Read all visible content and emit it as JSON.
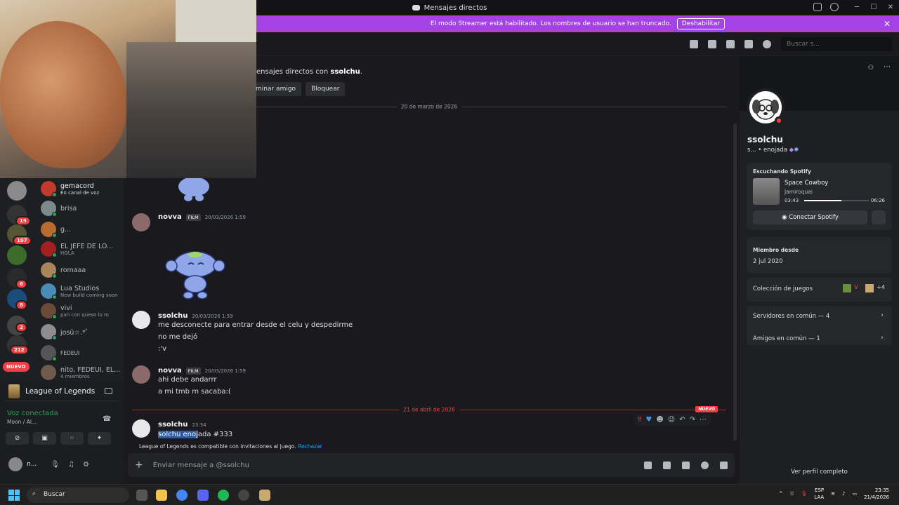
{
  "window": {
    "title": "Mensajes directos"
  },
  "banner": {
    "text": "El modo Streamer está habilitado. Los nombres de usuario se han truncado.",
    "button": "Deshabilitar"
  },
  "search": {
    "placeholder": "Buscar s..."
  },
  "servers": {
    "badges": [
      "15",
      "107",
      "6",
      "8",
      "2",
      "212"
    ],
    "nuevo": "NUEVO"
  },
  "dms": [
    {
      "name": "gemacord",
      "sub": "En canal de voz",
      "color": "#c0392b"
    },
    {
      "name": "brisa",
      "sub": "",
      "color": "#7d8a8b"
    },
    {
      "name": "g...",
      "sub": "",
      "color": "#b86b2e"
    },
    {
      "name": "EL JEFE DE LO...",
      "sub": "HOLA",
      "color": "#a32020"
    },
    {
      "name": "romaaa",
      "sub": "",
      "color": "#a8855a"
    },
    {
      "name": "Lua Studios",
      "sub": "New build coming soon",
      "color": "#4a8cb8"
    },
    {
      "name": "vivi",
      "sub": "pan con queso lo m",
      "color": "#6b4a3a"
    },
    {
      "name": "josü☆.*ﾟ",
      "sub": "",
      "color": "#8e8e8e"
    },
    {
      "name": "FEDEUI",
      "sub": "",
      "color": "#555555"
    },
    {
      "name": "nito, FEDEUI, EL ...",
      "sub": "4 miembros",
      "color": "#6f5b4b"
    }
  ],
  "activity": {
    "game": "League of Legends",
    "voice_title": "Voz conectada",
    "voice_sub": "Moon / Al..."
  },
  "user": {
    "name": "n..."
  },
  "chat": {
    "intro_prefix": "ensajes directos con",
    "intro_user": "ssolchu",
    "intro_btn1": "minar amigo",
    "intro_btn2": "Bloquear",
    "date1": "20 de marzo de 2026",
    "date2": "21 de abril de 2026",
    "nuevo": "NUEVO",
    "messages": [
      {
        "author": "novva",
        "tag": "FILM",
        "ts": "20/03/2026 1:59"
      },
      {
        "author": "ssolchu",
        "ts": "20/03/2026 1:59",
        "lines": [
          "me desconecte para entrar desde el celu y despedirme",
          "no me dejó",
          ":'v"
        ]
      },
      {
        "author": "novva",
        "tag": "FILM",
        "ts": "20/03/2026 1:59",
        "lines": [
          "ahi debe andarrr",
          "a mi tmb m sacaba:("
        ]
      },
      {
        "author": "ssolchu",
        "ts": "23:34",
        "sel": "solchu enoj",
        "rest": "ada #333"
      }
    ],
    "gamelink_game": "League of Legends",
    "gamelink_text": "es compatible con invitaciones al juego.",
    "gamelink_action": "Rechazar"
  },
  "composer": {
    "placeholder": "Enviar mensaje a @ssolchu"
  },
  "profile": {
    "name": "ssolchu",
    "status": "s... • enojada",
    "spotify_label": "Escuchando Spotify",
    "song": "Space Cowboy",
    "artist": "Jamiroquai",
    "elapsed": "03:43",
    "duration": "06:26",
    "progress": 0.58,
    "connect": "Conectar Spotify",
    "member_label": "Miembro desde",
    "member_value": "2 jul 2020",
    "games_label": "Colección de juegos",
    "games_more": "+4",
    "servers": "Servidores en común — 4",
    "friends": "Amigos en común — 1",
    "view_full": "Ver perfil completo"
  },
  "taskbar": {
    "search": "Buscar",
    "lang1": "ESP",
    "lang2": "LAA",
    "time": "23:35",
    "date": "21/4/2026"
  }
}
